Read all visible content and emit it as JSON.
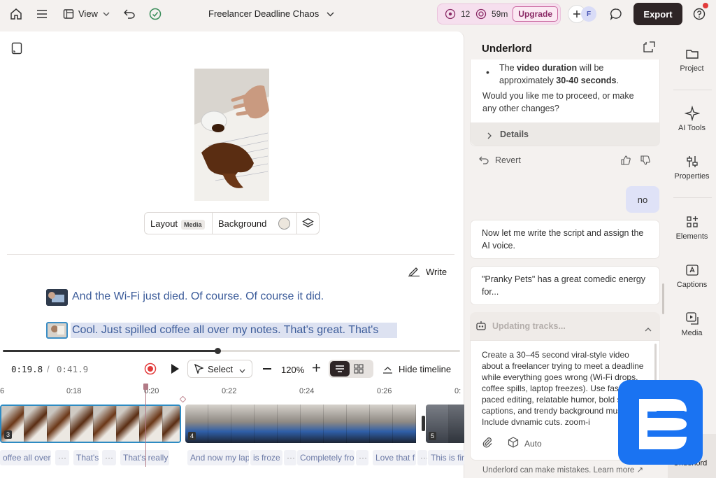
{
  "topbar": {
    "view_label": "View",
    "project_title": "Freelancer Deadline Chaos",
    "credits_count": "12",
    "time_left": "59m",
    "upgrade_label": "Upgrade",
    "avatar_initial": "F",
    "export_label": "Export"
  },
  "canvas": {
    "layout_label": "Layout",
    "media_badge": "Media",
    "background_label": "Background",
    "write_label": "Write"
  },
  "script": {
    "lines": [
      "And the Wi-Fi just died. Of course. Of course it did.",
      "Cool. Just spilled coffee all over my notes. That's great. That's"
    ]
  },
  "playback": {
    "current_time": "0:19.8",
    "separator": "/",
    "total_time": "0:41.9",
    "select_label": "Select",
    "zoom": "120%",
    "hide_timeline_label": "Hide timeline",
    "progress": 0.47
  },
  "ruler": {
    "ticks": [
      "6",
      "0:18",
      "0:20",
      "0:22",
      "0:24",
      "0:26",
      "0:"
    ]
  },
  "clips": [
    {
      "num": "3"
    },
    {
      "num": "4"
    },
    {
      "num": "5"
    }
  ],
  "words": [
    "offee all over",
    "···",
    "That's",
    "···",
    "That's really",
    "And now my lap",
    "is froze",
    "···",
    "Completely fro",
    "···",
    "Love that f",
    "···",
    "This is fin"
  ],
  "assistant": {
    "title": "Underlord",
    "bullet_prefix": "The ",
    "bullet_bold1": "video duration",
    "bullet_mid": " will be approximately ",
    "bullet_bold2": "30-40 seconds",
    "bullet_end": ".",
    "question": "Would you like me to proceed, or make any other changes?",
    "details_label": "Details",
    "revert_label": "Revert",
    "user_reply": "no",
    "msg1": "Now let me write the script and assign the AI voice.",
    "msg2": "\"Pranky Pets\" has a great comedic energy for...",
    "status": "Updating tracks...",
    "prompt_text": "Create a 30–45 second viral-style video about a freelancer trying to meet a deadline while everything goes wrong (Wi-Fi drops, coffee spills, laptop freezes). Use fast-paced editing, relatable humor, bold style captions, and trendy background music. Include dynamic cuts, zoom-i",
    "auto_label": "Auto",
    "disclaimer": "Underlord can make mistakes. Learn more ↗"
  },
  "sidebar": {
    "items": [
      "Project",
      "AI Tools",
      "Properties",
      "Elements",
      "Captions",
      "Media",
      "Underlord"
    ]
  },
  "colors": {
    "accent": "#3c5c9a",
    "upgrade": "#8b2a66",
    "export_bg": "#2e2526",
    "logo_blue": "#1a73f2",
    "record_red": "#e23b3b"
  }
}
